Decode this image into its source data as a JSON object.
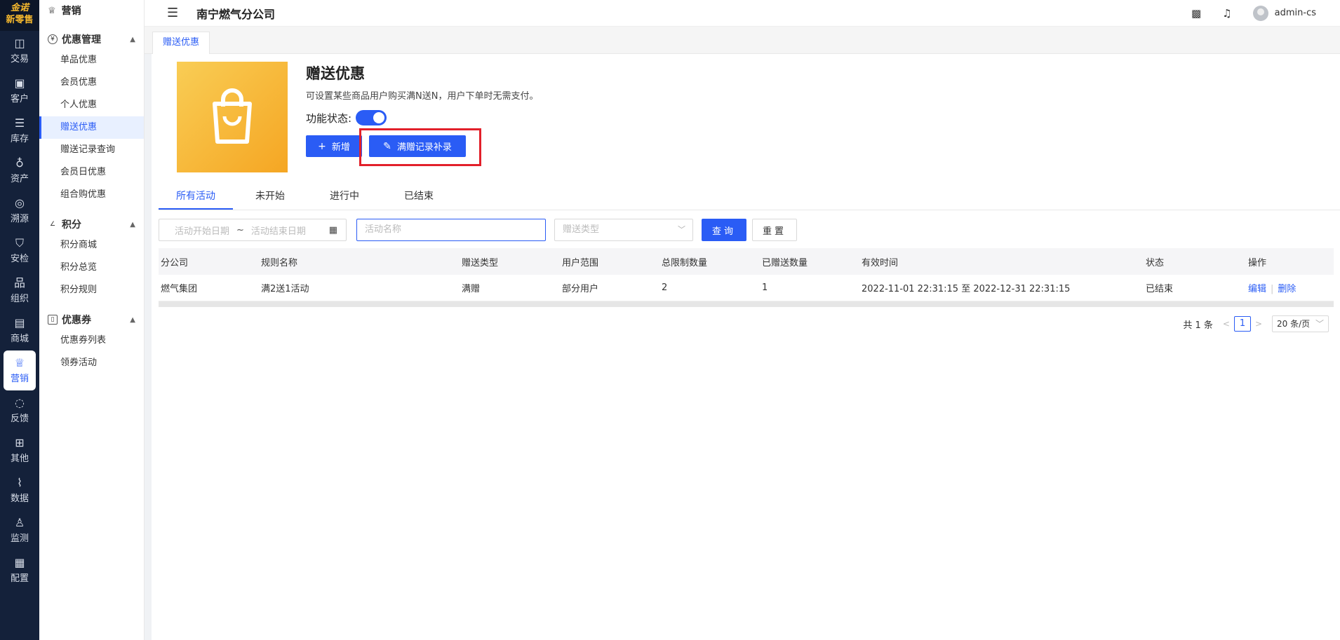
{
  "brand": {
    "line1": "金诺",
    "line2": "新零售"
  },
  "rail": [
    {
      "label": "交易",
      "icon": "bag-icon",
      "glyph": "◫"
    },
    {
      "label": "客户",
      "icon": "id-card-icon",
      "glyph": "▣"
    },
    {
      "label": "库存",
      "icon": "list-icon",
      "glyph": "☰"
    },
    {
      "label": "资产",
      "icon": "lightbulb-icon",
      "glyph": "♁"
    },
    {
      "label": "溯源",
      "icon": "compass-icon",
      "glyph": "◎"
    },
    {
      "label": "安检",
      "icon": "shield-icon",
      "glyph": "⛉"
    },
    {
      "label": "组织",
      "icon": "org-icon",
      "glyph": "品"
    },
    {
      "label": "商城",
      "icon": "store-icon",
      "glyph": "▤"
    },
    {
      "label": "营销",
      "icon": "trophy-icon",
      "glyph": "♕",
      "active": true
    },
    {
      "label": "反馈",
      "icon": "chat-icon",
      "glyph": "◌"
    },
    {
      "label": "其他",
      "icon": "blocks-icon",
      "glyph": "⊞"
    },
    {
      "label": "数据",
      "icon": "chart-icon",
      "glyph": "⌇"
    },
    {
      "label": "监测",
      "icon": "alarm-icon",
      "glyph": "♙"
    },
    {
      "label": "配置",
      "icon": "grid-icon",
      "glyph": "▦"
    }
  ],
  "sidebar": {
    "header": "营销",
    "groups": [
      {
        "title": "优惠管理",
        "items": [
          "单品优惠",
          "会员优惠",
          "个人优惠",
          "赠送优惠",
          "赠送记录查询",
          "会员日优惠",
          "组合购优惠"
        ],
        "active": 3
      },
      {
        "title": "积分",
        "items": [
          "积分商城",
          "积分总览",
          "积分规则"
        ]
      },
      {
        "title": "优惠券",
        "items": [
          "优惠券列表",
          "领券活动"
        ]
      }
    ]
  },
  "header": {
    "company": "南宁燃气分公司",
    "username": "admin-cs"
  },
  "page_tab": "赠送优惠",
  "main": {
    "title": "赠送优惠",
    "description": "可设置某些商品用户购买满N送N，用户下单时无需支付。",
    "status_label": "功能状态:",
    "add_button": "新增",
    "supplement_button": "满赠记录补录",
    "tabs": [
      "所有活动",
      "未开始",
      "进行中",
      "已结束"
    ],
    "active_tab": 0,
    "filters": {
      "start_date_placeholder": "活动开始日期",
      "range_separator": "~",
      "end_date_placeholder": "活动结束日期",
      "name_placeholder": "活动名称",
      "type_placeholder": "赠送类型",
      "query_button": "查询",
      "reset_button": "重置"
    },
    "table": {
      "headers": [
        "分公司",
        "规则名称",
        "赠送类型",
        "用户范围",
        "总限制数量",
        "已赠送数量",
        "有效时间",
        "状态",
        "操作"
      ],
      "rows": [
        {
          "company": "燃气集团",
          "rule": "满2送1活动",
          "type": "满赠",
          "scope": "部分用户",
          "limit": "2",
          "given": "1",
          "valid": "2022-11-01 22:31:15 至 2022-12-31 22:31:15",
          "status": "已结束",
          "edit": "编辑",
          "delete": "删除"
        }
      ]
    },
    "pagination": {
      "total": "共 1 条",
      "page": "1",
      "page_size": "20 条/页"
    }
  },
  "colors": {
    "primary": "#2a5cf5",
    "rail": "#14213a",
    "highlight": "#e2202a",
    "banner": "#f5a623"
  }
}
